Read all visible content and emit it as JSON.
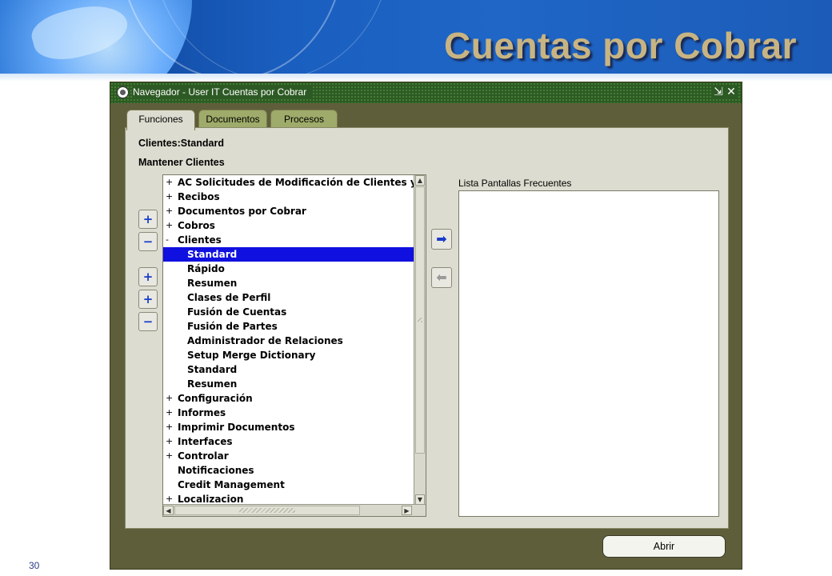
{
  "slide": {
    "title": "Cuentas por Cobrar",
    "page_number": "30"
  },
  "window": {
    "title": "Navegador - User IT Cuentas por Cobrar",
    "minimize_glyph": "⇲",
    "close_glyph": "✕"
  },
  "tabs": [
    {
      "label": "Funciones",
      "active": true
    },
    {
      "label": "Documentos",
      "active": false
    },
    {
      "label": "Procesos",
      "active": false
    }
  ],
  "panel": {
    "context_path": "Clientes:Standard",
    "section_title": "Mantener Clientes"
  },
  "side_buttons": {
    "expand": "+",
    "collapse": "−",
    "expand_branch": "+",
    "expand_all": "+",
    "collapse_all": "−"
  },
  "tree": {
    "items": [
      {
        "exp": "+",
        "label": "AC Solicitudes de Modificación de Clientes y D",
        "level": 0
      },
      {
        "exp": "+",
        "label": "Recibos",
        "level": 0
      },
      {
        "exp": "+",
        "label": "Documentos por Cobrar",
        "level": 0
      },
      {
        "exp": "+",
        "label": "Cobros",
        "level": 0
      },
      {
        "exp": "-",
        "label": "Clientes",
        "level": 0
      },
      {
        "exp": "",
        "label": "Standard",
        "level": 1,
        "selected": true
      },
      {
        "exp": "",
        "label": "Rápido",
        "level": 1
      },
      {
        "exp": "",
        "label": "Resumen",
        "level": 1
      },
      {
        "exp": "",
        "label": "Clases de Perfil",
        "level": 1
      },
      {
        "exp": "",
        "label": "Fusión de Cuentas",
        "level": 1
      },
      {
        "exp": "",
        "label": "Fusión de Partes",
        "level": 1
      },
      {
        "exp": "",
        "label": "Administrador de Relaciones",
        "level": 1
      },
      {
        "exp": "",
        "label": "Setup Merge Dictionary",
        "level": 1
      },
      {
        "exp": "",
        "label": "Standard",
        "level": 1
      },
      {
        "exp": "",
        "label": "Resumen",
        "level": 1
      },
      {
        "exp": "+",
        "label": "Configuración",
        "level": 0
      },
      {
        "exp": "+",
        "label": "Informes",
        "level": 0
      },
      {
        "exp": "+",
        "label": "Imprimir Documentos",
        "level": 0
      },
      {
        "exp": "+",
        "label": "Interfaces",
        "level": 0
      },
      {
        "exp": "+",
        "label": "Controlar",
        "level": 0
      },
      {
        "exp": "",
        "label": "Notificaciones",
        "level": 0
      },
      {
        "exp": "",
        "label": "Credit Management",
        "level": 0
      },
      {
        "exp": "+",
        "label": "Localizacion",
        "level": 0
      }
    ]
  },
  "transfer": {
    "add_glyph": "➡",
    "remove_glyph": "⬅"
  },
  "frequent": {
    "label": "Lista Pantallas Frecuentes",
    "items": []
  },
  "open_button": {
    "label": "Abrir"
  },
  "colors": {
    "banner": "#1a5fc0",
    "title_text": "#c8b482",
    "titlebar": "#2d5a24",
    "window_bg": "#5e5e3a",
    "panel_bg": "#dcdcd0",
    "selection": "#1010e0",
    "inactive_tab": "#9eab6a"
  }
}
